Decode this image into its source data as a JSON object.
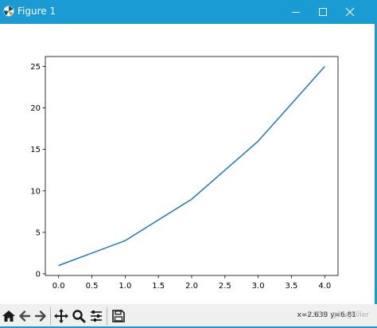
{
  "window": {
    "title": "Figure 1",
    "accent_color": "#1b9bd3",
    "icons": {
      "app": "matplotlib-icon",
      "minimize": "minimize-icon",
      "maximize": "maximize-icon",
      "close": "close-icon"
    }
  },
  "chart_data": {
    "type": "line",
    "title": "",
    "xlabel": "",
    "ylabel": "",
    "x": [
      0,
      1,
      2,
      3,
      4
    ],
    "series": [
      {
        "values": [
          1,
          4,
          9,
          16,
          25
        ],
        "color": "#1f77b4"
      }
    ],
    "xlim": [
      -0.2,
      4.2
    ],
    "ylim": [
      -0.2,
      26.2
    ],
    "x_ticks": [
      0.0,
      0.5,
      1.0,
      1.5,
      2.0,
      2.5,
      3.0,
      3.5,
      4.0
    ],
    "x_tick_labels": [
      "0.0",
      "0.5",
      "1.0",
      "1.5",
      "2.0",
      "2.5",
      "3.0",
      "3.5",
      "4.0"
    ],
    "y_ticks": [
      0,
      5,
      10,
      15,
      20,
      25
    ],
    "y_tick_labels": [
      "0",
      "5",
      "10",
      "15",
      "20",
      "25"
    ],
    "grid": false,
    "legend": "none"
  },
  "toolbar": {
    "icons": [
      "home-icon",
      "back-arrow-icon",
      "forward-arrow-icon",
      "pan-icon",
      "zoom-icon",
      "configure-subplots-icon",
      "save-icon"
    ],
    "coordinates": "x=2.639 y=6.81",
    "watermark": "CSDN @Bugkiller"
  }
}
